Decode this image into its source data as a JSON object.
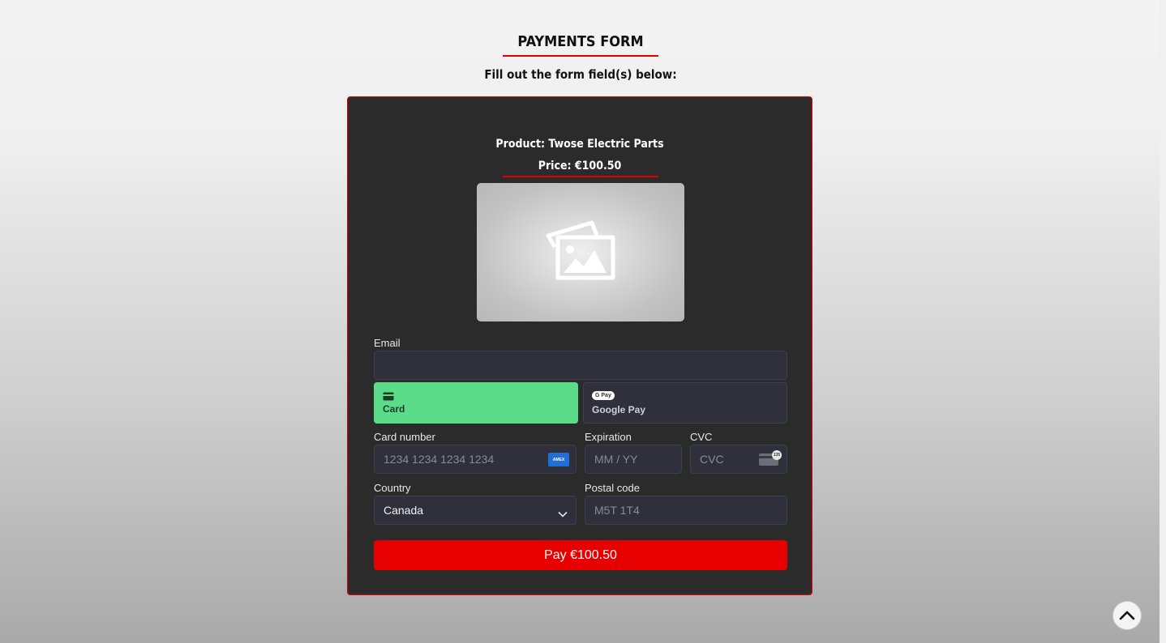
{
  "header": {
    "title": "PAYMENTS FORM",
    "subtitle": "Fill out the form field(s) below:"
  },
  "product": {
    "name": "Product: Twose Electric Parts",
    "price": "Price: €100.50",
    "image_icon": "photo-placeholder-icon"
  },
  "form": {
    "email_label": "Email",
    "email_value": "",
    "payment_methods": [
      {
        "label": "Card",
        "icon": "credit-card-icon",
        "selected": true
      },
      {
        "label": "Google Pay",
        "icon": "google-pay-icon",
        "icon_text": "G Pay",
        "selected": false
      }
    ],
    "card_number_label": "Card number",
    "card_number_placeholder": "1234 1234 1234 1234",
    "card_brand_text": "AMEX",
    "expiration_label": "Expiration",
    "expiration_placeholder": "MM / YY",
    "cvc_label": "CVC",
    "cvc_placeholder": "CVC",
    "cvc_icon_text": "135",
    "country_label": "Country",
    "country_value": "Canada",
    "postal_label": "Postal code",
    "postal_placeholder": "M5T 1T4",
    "pay_label": "Pay €100.50"
  },
  "colors": {
    "accent": "#e00000",
    "panel": "#2b2b2b",
    "selected_tab": "#5bdc89",
    "field_bg": "#30303d"
  }
}
